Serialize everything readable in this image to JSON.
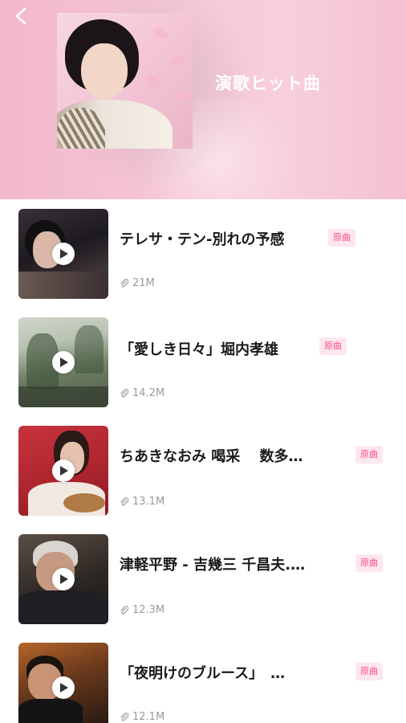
{
  "header": {
    "title": "演歌ヒット曲",
    "back_icon": "back-arrow-icon"
  },
  "colors": {
    "badge_text": "#ff4d82",
    "badge_bg": "#fde7ee",
    "header_bg": "#f6c6d6"
  },
  "songs": [
    {
      "title": "テレサ・テン-別れの予感",
      "badge": "原曲",
      "size": "21M"
    },
    {
      "title": "「愛しき日々」堀内孝雄",
      "badge": "原曲",
      "size": "14.2M"
    },
    {
      "title": "ちあきなおみ  喝采　 数多…",
      "badge": "原曲",
      "size": "13.1M"
    },
    {
      "title": "津軽平野 - 吉幾三 千昌夫.…",
      "badge": "原曲",
      "size": "12.3M"
    },
    {
      "title": "「夜明けのブルース」　…",
      "badge": "原曲",
      "size": "12.1M"
    }
  ]
}
